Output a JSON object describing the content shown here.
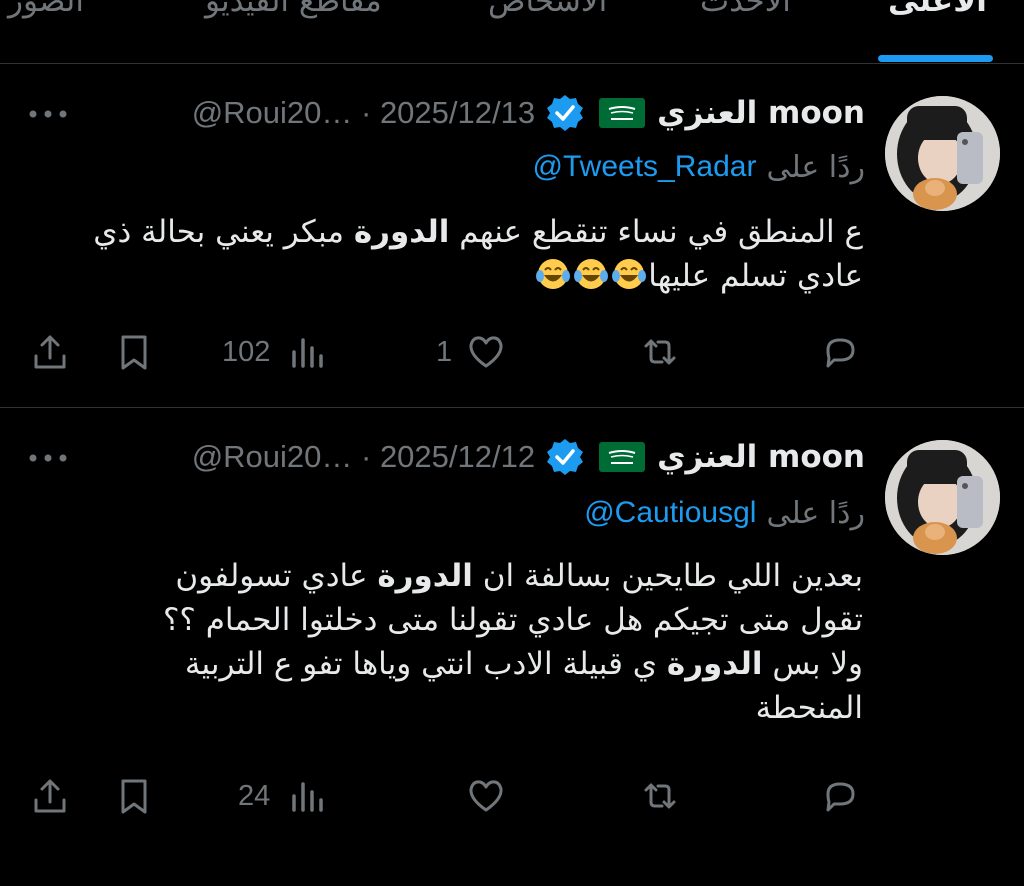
{
  "tabs": [
    {
      "label": "الأعلى",
      "active": true
    },
    {
      "label": "الأحدث",
      "active": false
    },
    {
      "label": "الأشخاص",
      "active": false
    },
    {
      "label": "مقاطع الفيديو",
      "active": false
    },
    {
      "label": "الصور",
      "active": false
    }
  ],
  "accent_color": "#1d9bf0",
  "tweets": [
    {
      "display_name": "العنزي moon",
      "handle_date": "@Roui20… · 2025/12/13",
      "reply_label": "ردًا على",
      "reply_handle": "@Tweets_Radar",
      "body_parts": [
        "ع المنطق في نساء تنقطع عنهم ",
        "الدورة",
        " مبكر يعني بحالة ذي عادي تسلم عليها"
      ],
      "emoji_count": 3,
      "emoji_name": "face-with-tears-of-joy",
      "views": "102",
      "likes": "1"
    },
    {
      "display_name": "العنزي moon",
      "handle_date": "@Roui20… · 2025/12/12",
      "reply_label": "ردًا على",
      "reply_handle": "@Cautiousgl",
      "lines": [
        [
          "بعدين اللي طايحين بسالفة  ان ",
          "الدورة",
          " عادي تسولفون"
        ],
        [
          "تقول متى تجيكم هل عادي تقولنا متى دخلتوا الحمام ؟؟"
        ],
        [
          "ولا بس ",
          "الدورة",
          " ي قبيلة الادب انتي وياها تفو ع التربية"
        ],
        [
          "المنحطة"
        ]
      ],
      "views": "24",
      "likes": ""
    }
  ]
}
